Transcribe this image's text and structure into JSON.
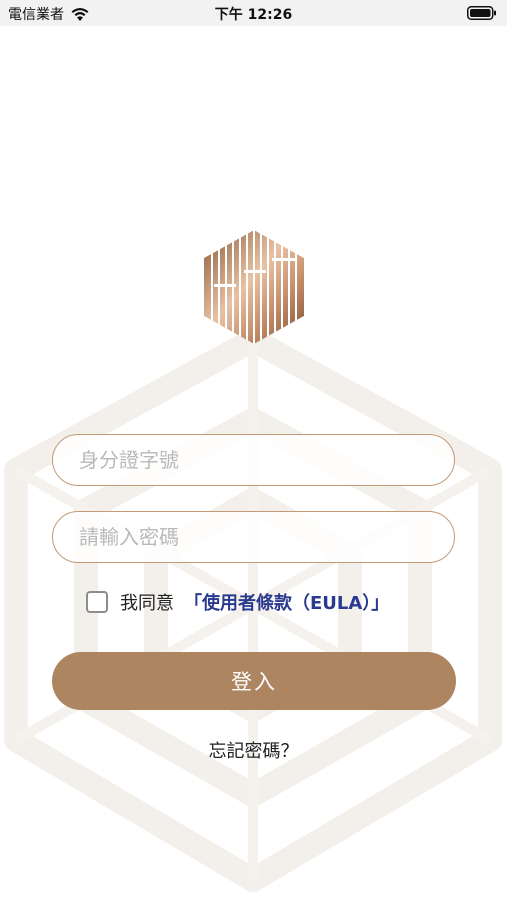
{
  "status_bar": {
    "carrier": "電信業者",
    "time": "下午 12:26",
    "wifi_icon": "wifi-icon",
    "battery_icon": "battery-icon"
  },
  "logo": {
    "icon": "hexagon-logo-icon",
    "colors": [
      "#8a5a3c",
      "#e8c2a4",
      "#b07a58"
    ]
  },
  "form": {
    "id_placeholder": "身分證字號",
    "id_value": "",
    "password_placeholder": "請輸入密碼",
    "password_value": "",
    "agree_label": "我同意",
    "eula_link": "「使用者條款（EULA）」",
    "agree_checked": false,
    "login_label": "登入",
    "forgot_label": "忘記密碼？"
  },
  "colors": {
    "accent": "#ad8561",
    "field_border": "#c29a78",
    "link": "#2a3a8f"
  }
}
